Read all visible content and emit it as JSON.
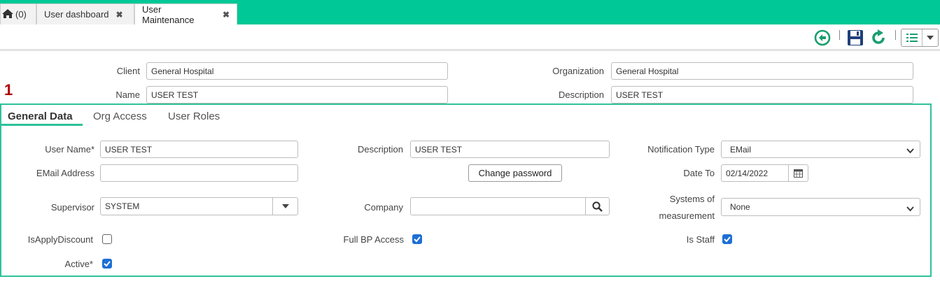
{
  "tabs": {
    "home_label": "(0)",
    "dashboard_label": "User dashboard",
    "maintenance_label": "User Maintenance",
    "close_glyph": "✖"
  },
  "header": {
    "client_label": "Client",
    "client_value": "General Hospital",
    "organization_label": "Organization",
    "organization_value": "General Hospital",
    "name_label": "Name",
    "name_value": "USER TEST",
    "description_label": "Description",
    "description_value": "USER TEST"
  },
  "annotation_marker": "1",
  "subtabs": {
    "general": "General Data",
    "org_access": "Org Access",
    "user_roles": "User Roles"
  },
  "form": {
    "user_name_label": "User Name*",
    "user_name_value": "USER TEST",
    "description_label": "Description",
    "description_value": "USER TEST",
    "notification_label": "Notification Type",
    "notification_value": "EMail",
    "email_label": "EMail Address",
    "email_value": "",
    "change_password_label": "Change password",
    "date_to_label": "Date To",
    "date_to_value": "02/14/2022",
    "supervisor_label": "Supervisor",
    "supervisor_value": "SYSTEM",
    "company_label": "Company",
    "company_value": "",
    "systems_label_line1": "Systems of",
    "systems_label_line2": "measurement",
    "systems_value": "None",
    "apply_discount_label": "IsApplyDiscount",
    "apply_discount_checked": false,
    "full_bp_label": "Full BP Access",
    "full_bp_checked": true,
    "is_staff_label": "Is Staff",
    "is_staff_checked": true,
    "active_label": "Active*",
    "active_checked": true
  },
  "colors": {
    "accent": "#00c896",
    "panel_border": "#2ec29a",
    "checkbox": "#1d6fd6",
    "annotation": "#b00000",
    "toolbar_icon": "#1a9e6e",
    "save_icon": "#1f3f7a"
  },
  "icons": [
    "home-icon",
    "close-icon",
    "back-icon",
    "save-icon",
    "refresh-icon",
    "list-icon",
    "dropdown-icon",
    "search-icon",
    "calendar-icon",
    "chevron-down-icon",
    "check-icon"
  ]
}
